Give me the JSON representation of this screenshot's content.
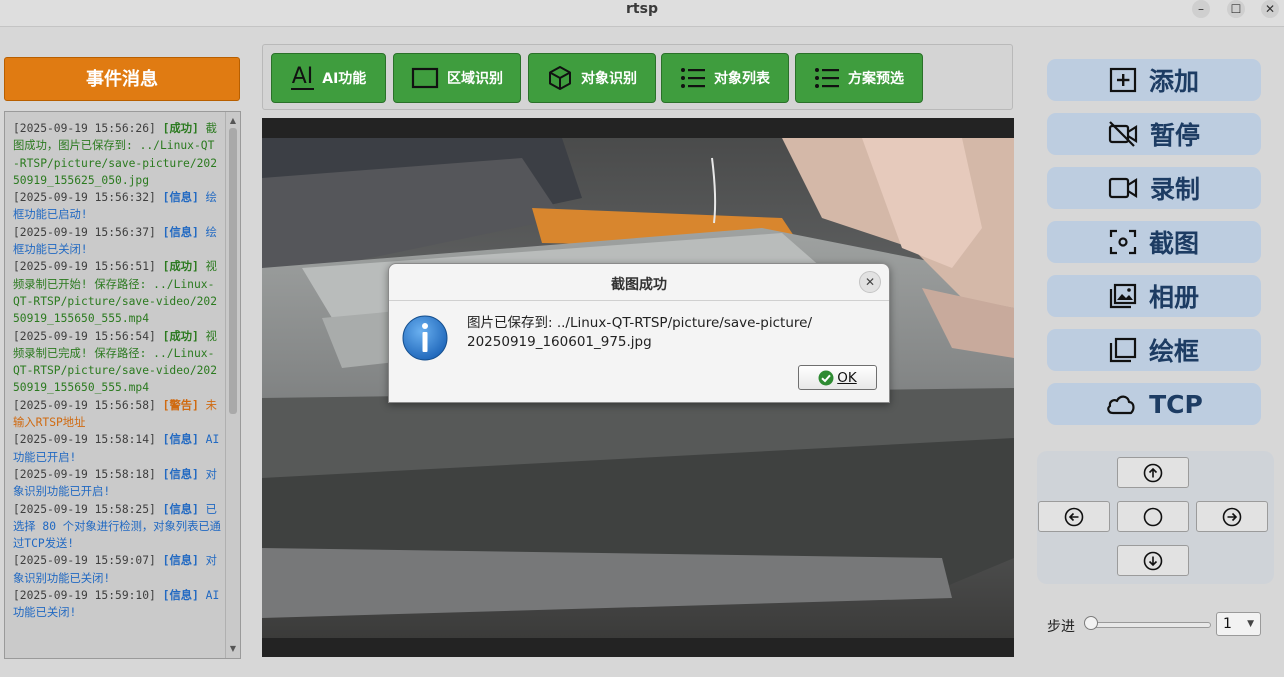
{
  "window": {
    "title": "rtsp",
    "controls": [
      "–",
      "☐",
      "✕"
    ]
  },
  "event_panel": {
    "header": "事件消息",
    "entries": [
      {
        "time": "[2025-09-19 15:56:26]",
        "tag": "[成功]",
        "level": "success",
        "text": "截图成功，图片已保存到: ../Linux-QT-RTSP/picture/save-picture/20250919_155625_050.jpg"
      },
      {
        "time": "[2025-09-19 15:56:32]",
        "tag": "[信息]",
        "level": "info",
        "text": "绘框功能已启动!"
      },
      {
        "time": "[2025-09-19 15:56:37]",
        "tag": "[信息]",
        "level": "info",
        "text": "绘框功能已关闭!"
      },
      {
        "time": "[2025-09-19 15:56:51]",
        "tag": "[成功]",
        "level": "success",
        "text": "视频录制已开始! 保存路径: ../Linux-QT-RTSP/picture/save-video/20250919_155650_555.mp4"
      },
      {
        "time": "[2025-09-19 15:56:54]",
        "tag": "[成功]",
        "level": "success",
        "text": "视频录制已完成! 保存路径: ../Linux-QT-RTSP/picture/save-video/20250919_155650_555.mp4"
      },
      {
        "time": "[2025-09-19 15:56:58]",
        "tag": "[警告]",
        "level": "warn",
        "text": "未输入RTSP地址"
      },
      {
        "time": "[2025-09-19 15:58:14]",
        "tag": "[信息]",
        "level": "info",
        "text": "AI功能已开启!"
      },
      {
        "time": "[2025-09-19 15:58:18]",
        "tag": "[信息]",
        "level": "info",
        "text": "对象识别功能已开启!"
      },
      {
        "time": "[2025-09-19 15:58:25]",
        "tag": "[信息]",
        "level": "info",
        "text": "已选择 80 个对象进行检测，对象列表已通过TCP发送!"
      },
      {
        "time": "[2025-09-19 15:59:07]",
        "tag": "[信息]",
        "level": "info",
        "text": "对象识别功能已关闭!"
      },
      {
        "time": "[2025-09-19 15:59:10]",
        "tag": "[信息]",
        "level": "info",
        "text": "AI功能已关闭!"
      }
    ]
  },
  "toolbar": {
    "ai_label": "AI功能",
    "ai_icon_text": "AI",
    "region_label": "区域识别",
    "object_label": "对象识别",
    "object_list_label": "对象列表",
    "scheme_label": "方案预选"
  },
  "dialog": {
    "title": "截图成功",
    "close": "✕",
    "message_line1": "图片已保存到: ../Linux-QT-RTSP/picture/save-picture/",
    "message_line2": "20250919_160601_975.jpg",
    "ok_label": "OK"
  },
  "controls": {
    "add_label": "添加",
    "pause_label": "暂停",
    "record_label": "录制",
    "screenshot_label": "截图",
    "album_label": "相册",
    "draw_label": "绘框",
    "tcp_label": "TCP"
  },
  "step": {
    "label": "步进",
    "value": "1",
    "slider_value": 0
  },
  "colors": {
    "event_header": "#e07b12",
    "tool_button": "#3f9d3e",
    "side_button": "#bdcde0",
    "side_text": "#1d3c63"
  }
}
